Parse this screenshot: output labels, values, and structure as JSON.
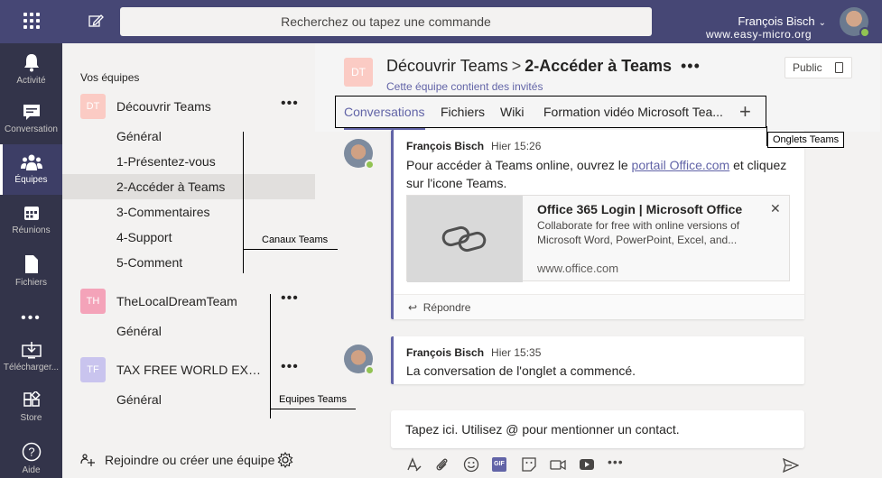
{
  "topbar": {
    "search_placeholder": "Recherchez ou tapez une commande",
    "user_name": "François Bisch",
    "user_site": "www.easy-micro.org"
  },
  "rail": {
    "items": [
      {
        "label": "Activité",
        "icon": "bell-icon"
      },
      {
        "label": "Conversation",
        "icon": "chat-icon"
      },
      {
        "label": "Équipes",
        "icon": "teams-icon"
      },
      {
        "label": "Réunions",
        "icon": "calendar-icon"
      },
      {
        "label": "Fichiers",
        "icon": "file-icon"
      },
      {
        "label": "Télécharger...",
        "icon": "download-icon"
      },
      {
        "label": "Store",
        "icon": "store-icon"
      },
      {
        "label": "Aide",
        "icon": "help-icon"
      }
    ],
    "more": "•••"
  },
  "teams": {
    "section_title": "Vos équipes",
    "list": [
      {
        "initials": "DT",
        "name": "Découvrir Teams",
        "color": "#fbcbc4",
        "channels": [
          "Général",
          "1-Présentez-vous",
          "2-Accéder à Teams",
          "3-Commentaires",
          "4-Support",
          "5-Comment"
        ]
      },
      {
        "initials": "TH",
        "name": "TheLocalDreamTeam",
        "color": "#f4a3b9",
        "channels": [
          "Général"
        ]
      },
      {
        "initials": "TF",
        "name": "TAX FREE WORLD EXHIBI...",
        "color": "#c9c4ee",
        "channels": [
          "Général"
        ]
      }
    ],
    "more": "•••",
    "join_label": "Rejoindre ou créer une équipe"
  },
  "header": {
    "avatar": "DT",
    "team": "Découvrir Teams",
    "separator": ">",
    "channel": "2-Accéder à Teams",
    "more": "•••",
    "guests_note": "Cette équipe contient des invités",
    "public_label": "Public",
    "tabs": [
      "Conversations",
      "Fichiers",
      "Wiki",
      "Formation vidéo Microsoft Tea..."
    ],
    "add_tab": "+"
  },
  "annotations": {
    "tabs": "Onglets Teams",
    "channels": "Canaux Teams",
    "teams": "Equipes Teams"
  },
  "messages": [
    {
      "author": "François Bisch",
      "time": "Hier 15:26",
      "text_before": "Pour accéder à Teams online, ouvrez le ",
      "link": "portail Office.com",
      "text_after": " et cliquez sur l'icone Teams.",
      "card": {
        "title": "Office 365 Login | Microsoft Office",
        "description": "Collaborate for free with online versions of Microsoft Word, PowerPoint, Excel, and...",
        "url": "www.office.com",
        "close": "✕"
      },
      "reply": "Répondre"
    },
    {
      "author": "François Bisch",
      "time": "Hier 15:35",
      "text": "La conversation de l'onglet a commencé."
    }
  ],
  "composer": {
    "placeholder": "Tapez ici. Utilisez @ pour mentionner un contact.",
    "gif_label": "GIF"
  },
  "colors": {
    "accent": "#6264a7",
    "topbar": "#464775",
    "rail": "#33344a",
    "presence": "#92c353"
  }
}
